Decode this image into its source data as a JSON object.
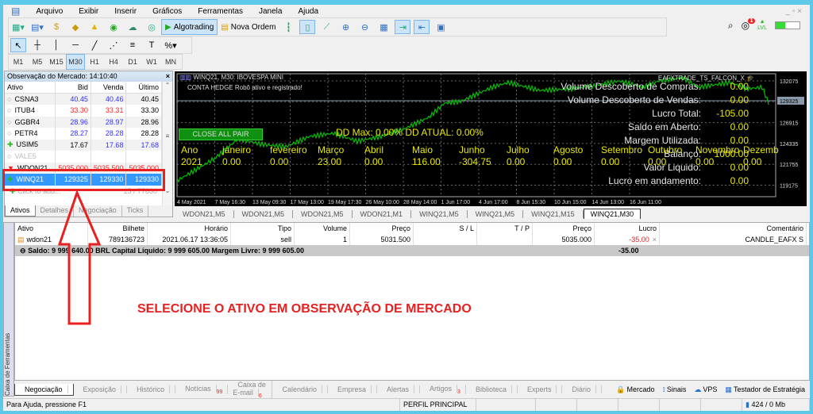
{
  "menu": [
    "Arquivo",
    "Exibir",
    "Inserir",
    "Gráficos",
    "Ferramentas",
    "Janela",
    "Ajuda"
  ],
  "toolbar": {
    "algotrading": "Algotrading",
    "nova_ordem": "Nova Ordem",
    "notifications_count": "1",
    "level_label": "LVL",
    "level_fill_percent": 40
  },
  "timeframes": [
    "M1",
    "M5",
    "M15",
    "M30",
    "H1",
    "H4",
    "D1",
    "W1",
    "MN"
  ],
  "timeframe_selected": "M30",
  "market_watch": {
    "title": "Observação do Mercado: 14:10:40",
    "columns": [
      "Ativo",
      "Bid",
      "Venda",
      "Último"
    ],
    "rows": [
      {
        "ativo": "CSNA3",
        "bid": "40.45",
        "venda": "40.46",
        "ultimo": "40.45"
      },
      {
        "ativo": "ITUB4",
        "bid": "33.30",
        "venda": "33.31",
        "ultimo": "33.30"
      },
      {
        "ativo": "GGBR4",
        "bid": "28.96",
        "venda": "28.97",
        "ultimo": "28.96"
      },
      {
        "ativo": "PETR4",
        "bid": "28.27",
        "venda": "28.28",
        "ultimo": "28.28"
      },
      {
        "ativo": "USIM5",
        "bid": "17.67",
        "venda": "17.68",
        "ultimo": "17.68"
      },
      {
        "ativo": "VALE5",
        "bid": "",
        "venda": "",
        "ultimo": ""
      },
      {
        "ativo": "WDON21",
        "bid": "5035.000",
        "venda": "5035.500",
        "ultimo": "5035.000"
      },
      {
        "ativo": "WINQ21",
        "bid": "129325",
        "venda": "129330",
        "ultimo": "129330"
      }
    ],
    "add_row": "Click to add...",
    "count": "15 / 77830",
    "tabs": [
      "Ativos",
      "Detalhes",
      "Negociação",
      "Ticks"
    ]
  },
  "chart": {
    "title": "WINQ21, M30:  IBOVESPA MINI",
    "subtitle": "CONTA HEDGE   Robô ativo e registrado!",
    "ea_name": "EAFXTRADE_TS_FALCON_X",
    "close_all": "CLOSE ALL PAIR",
    "dd": "DD Max: 0.00% DD ATUAL: 0.00%",
    "months": [
      "Ano",
      "janeiro",
      "fevereiro",
      "Março",
      "Abril",
      "Maio",
      "Junho",
      "Julho",
      "Agosto",
      "Setembro",
      "Outubro",
      "Novembro",
      "Dezemb"
    ],
    "values": [
      "2021",
      "0.00",
      "0.00",
      "23.00",
      "0.00",
      "116.00",
      "-304.75",
      "0.00",
      "0.00",
      "0.00",
      "0.00",
      "0.00",
      "0.00"
    ],
    "stats": [
      {
        "label": "Volume Descoberto de Compras:",
        "value": "0.00"
      },
      {
        "label": "Volume Descoberto de Vendas:",
        "value": "0.00"
      },
      {
        "label": "Lucro Total:",
        "value": "-105.00"
      },
      {
        "label": "Saldo em Aberto:",
        "value": "0.00"
      },
      {
        "label": "Margem Utilizada:",
        "value": "0.00"
      },
      {
        "label": "Balanço:",
        "value": "1000.00"
      },
      {
        "label": "Valor Liquido:",
        "value": "0.00"
      },
      {
        "label": "Lucro em andamento:",
        "value": "0.00"
      }
    ],
    "price_ticks": [
      "132075",
      "129325",
      "126915",
      "124335",
      "121755",
      "119175"
    ],
    "current_price": "129325",
    "time_ticks": [
      "4 May 2021",
      "7 May 16:30",
      "13 May 09:30",
      "17 May 13:00",
      "19 May 17:30",
      "26 May 10:00",
      "28 May 14:00",
      "1 Jun 17:00",
      "4 Jun 17:00",
      "8 Jun 15:30",
      "10 Jun 15:00",
      "14 Jun 13:00",
      "16 Jun 11:00"
    ],
    "line_color": "#00c000"
  },
  "chart_tabs": [
    "WDON21,M5",
    "WDON21,M5",
    "WDON21,M5",
    "WDON21,M1",
    "WINQ21,M5",
    "WINQ21,M5",
    "WINQ21,M15",
    "WINQ21,M30"
  ],
  "trade": {
    "columns": [
      "Ativo",
      "Bilhete",
      "Horário",
      "Tipo",
      "Volume",
      "Preço",
      "S / L",
      "T / P",
      "Preço",
      "Lucro",
      "Comentário"
    ],
    "row": [
      "wdon21",
      "789136723",
      "2021.06.17 13:36:05",
      "sell",
      "1",
      "5031.500",
      "",
      "",
      "5035.000",
      "-35.00",
      "CANDLE_EAFX S"
    ],
    "saldo": "Saldo: 9 999 640.00 BRL  Capital Líquido: 9 999 605.00  Margem Livre: 9 999 605.00",
    "total": "-35.00"
  },
  "annotation": "SELECIONE O ATIVO EM OBSERVAÇÃO DE MERCADO",
  "toolbox_label": "Caixa de Ferramentas",
  "bottom_tabs": [
    {
      "label": "Negociação"
    },
    {
      "label": "Exposição"
    },
    {
      "label": "Histórico"
    },
    {
      "label": "Notícias",
      "badge": "99"
    },
    {
      "label": "Caixa de E-mail",
      "badge": "6"
    },
    {
      "label": "Calendário"
    },
    {
      "label": "Empresa"
    },
    {
      "label": "Alertas"
    },
    {
      "label": "Artigos",
      "badge": "3"
    },
    {
      "label": "Biblioteca"
    },
    {
      "label": "Experts"
    },
    {
      "label": "Diário"
    }
  ],
  "right_links": [
    "Mercado",
    "Sinais",
    "VPS",
    "Testador de Estratégia"
  ],
  "status": {
    "help": "Para Ajuda, pressione F1",
    "profile": "PERFIL PRINCIPAL",
    "traffic": "424 / 0 Mb"
  }
}
